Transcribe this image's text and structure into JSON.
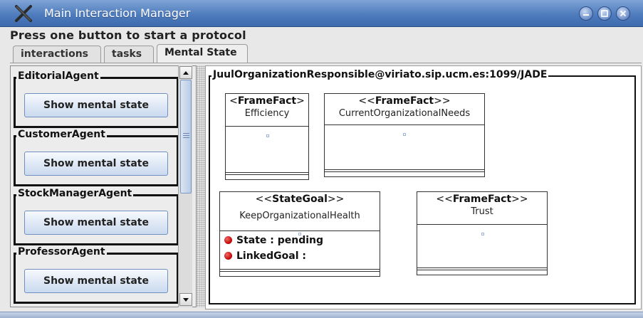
{
  "window": {
    "title": "Main Interaction Manager",
    "controls": [
      "minimize-icon",
      "maximize-icon",
      "close-icon"
    ]
  },
  "subtitle": "Press one button to start a protocol",
  "tabs": [
    {
      "label": "interactions",
      "active": false
    },
    {
      "label": "tasks",
      "active": false
    },
    {
      "label": "Mental State",
      "active": true
    }
  ],
  "agents": [
    {
      "name": "EditorialAgent",
      "button_label": "Show mental state"
    },
    {
      "name": "CustomerAgent",
      "button_label": "Show mental state"
    },
    {
      "name": "StockManagerAgent",
      "button_label": "Show mental state"
    },
    {
      "name": "ProfessorAgent",
      "button_label": "Show mental state"
    }
  ],
  "canvas": {
    "title": "JuulOrganizationResponsible@viriato.sip.ucm.es:1099/JADE",
    "entities": [
      {
        "stereotype": "FrameFact",
        "name": "Efficiency"
      },
      {
        "stereotype": "FrameFact",
        "name": "CurrentOrganizationalNeeds"
      },
      {
        "stereotype": "StateGoal",
        "name": "KeepOrganizationalHealth",
        "attributes": [
          "State : pending",
          "LinkedGoal :"
        ]
      },
      {
        "stereotype": "FrameFact",
        "name": "Trust"
      }
    ]
  },
  "colors": {
    "titlebar": "#4f7cbd",
    "bullet": "#c00000",
    "button": "#dde7f5"
  }
}
